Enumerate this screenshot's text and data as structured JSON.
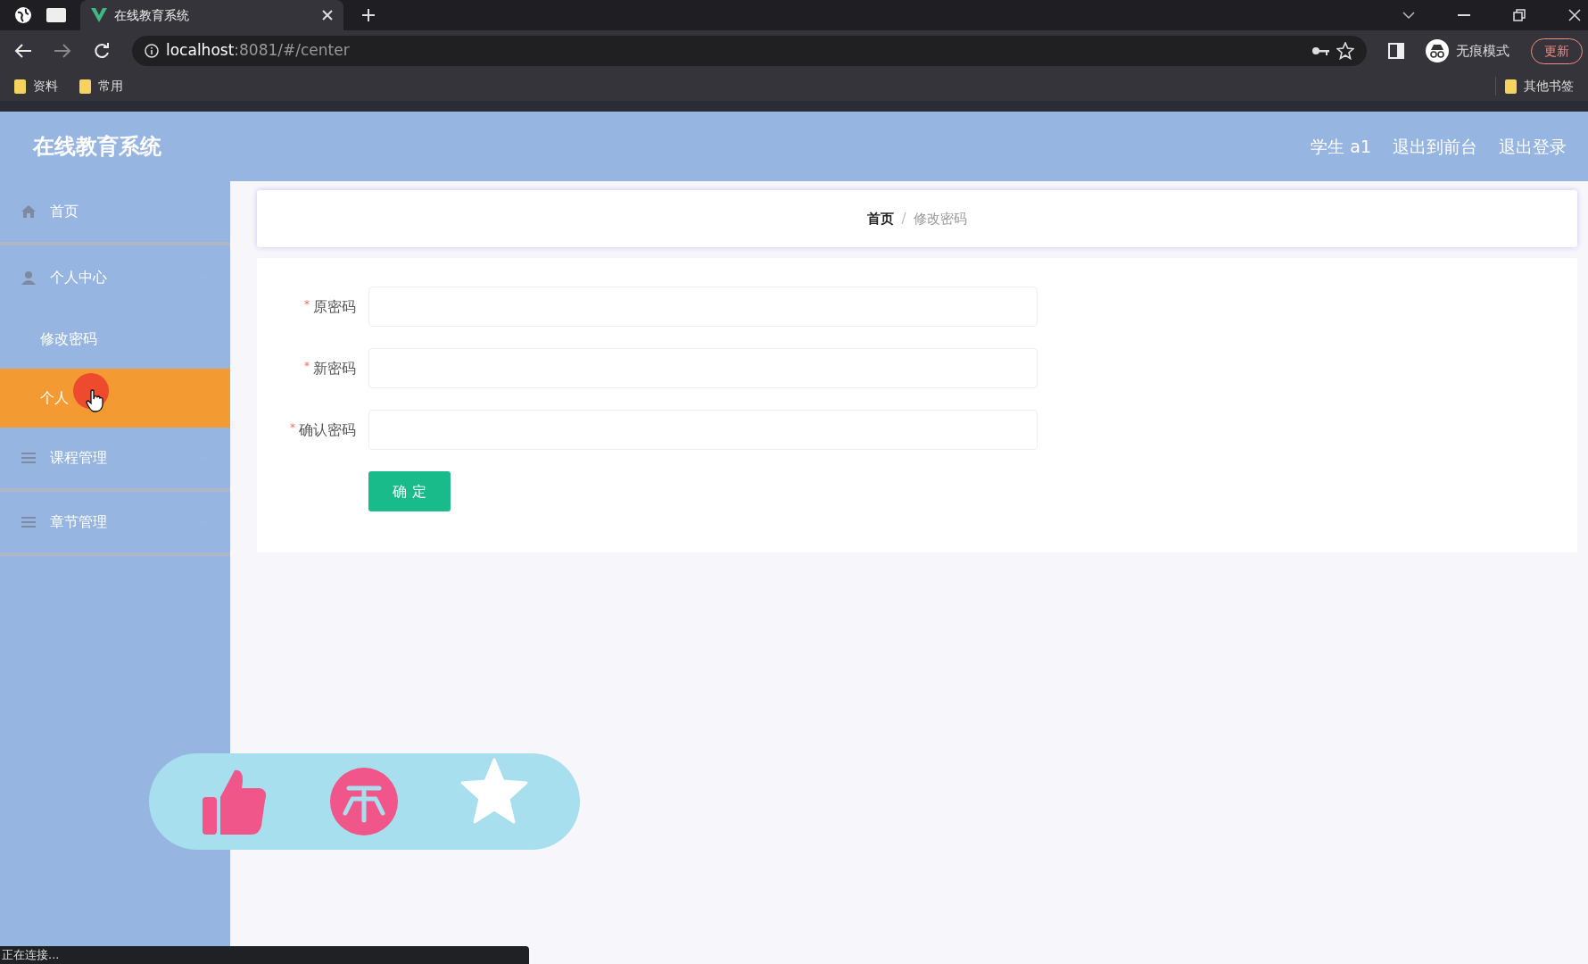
{
  "browser": {
    "tab_title": "在线教育系统",
    "url_host": "localhost",
    "url_rest": ":8081/#/center",
    "bookmarks": [
      "资料",
      "常用"
    ],
    "other_bookmarks": "其他书签",
    "incognito": "无痕模式",
    "update": "更新"
  },
  "header": {
    "title": "在线教育系统",
    "links": [
      "学生 a1",
      "退出到前台",
      "退出登录"
    ]
  },
  "sidebar": {
    "items": [
      {
        "label": "首页",
        "kind": "home",
        "expanded": false
      },
      {
        "label": "个人中心",
        "kind": "user",
        "expanded": true,
        "children": [
          {
            "label": "修改密码",
            "selected": false
          },
          {
            "label": "个人",
            "selected": true
          }
        ]
      },
      {
        "label": "课程管理",
        "kind": "list",
        "expanded": false
      },
      {
        "label": "章节管理",
        "kind": "list",
        "expanded": false
      }
    ]
  },
  "breadcrumb": {
    "separator": "/",
    "items": [
      {
        "label": "首页",
        "current": false
      },
      {
        "label": "修改密码",
        "current": true
      }
    ]
  },
  "form": {
    "fields": [
      {
        "label": "原密码",
        "required_mark": "*"
      },
      {
        "label": "新密码",
        "required_mark": "*"
      },
      {
        "label": "确认密码",
        "required_mark": "*"
      }
    ],
    "submit": "确 定"
  },
  "status_bar": "正在连接..."
}
